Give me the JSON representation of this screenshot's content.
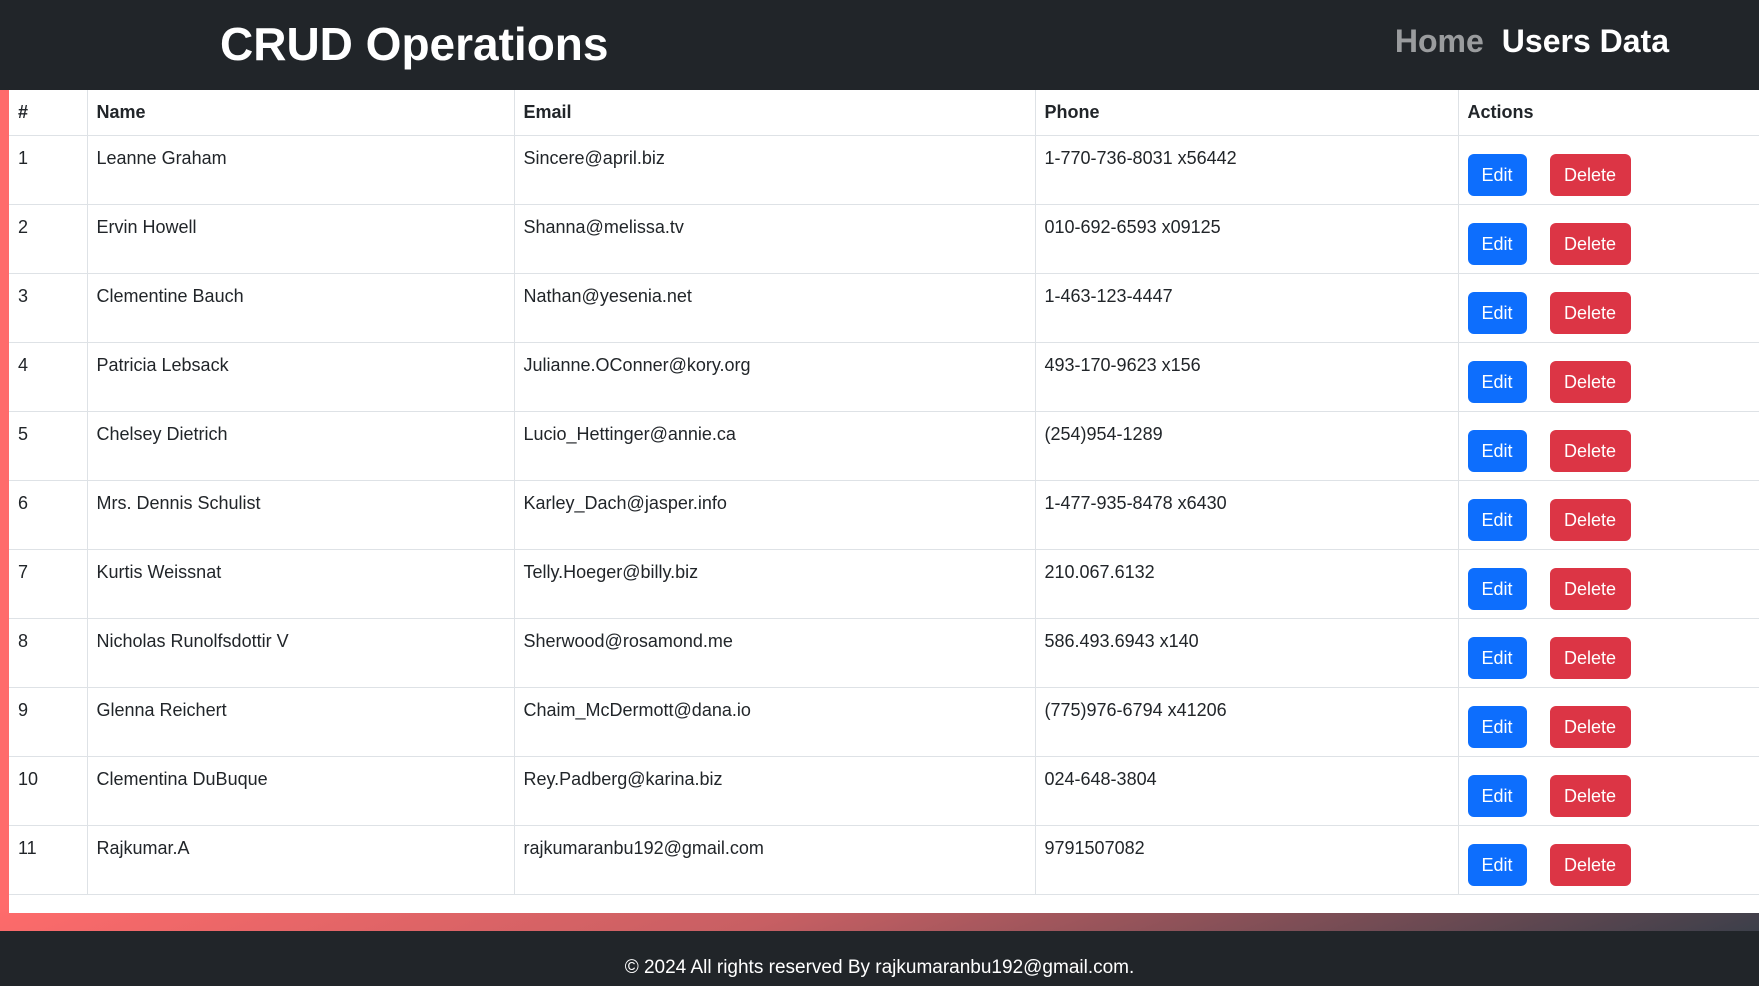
{
  "navbar": {
    "brand": "CRUD Operations",
    "links": [
      {
        "label": "Home",
        "active": false
      },
      {
        "label": "Users Data",
        "active": true
      }
    ]
  },
  "table": {
    "headers": [
      "#",
      "Name",
      "Email",
      "Phone",
      "Actions"
    ],
    "edit_label": "Edit",
    "delete_label": "Delete",
    "rows": [
      {
        "id": "1",
        "name": "Leanne Graham",
        "email": "Sincere@april.biz",
        "phone": "1-770-736-8031 x56442"
      },
      {
        "id": "2",
        "name": "Ervin Howell",
        "email": "Shanna@melissa.tv",
        "phone": "010-692-6593 x09125"
      },
      {
        "id": "3",
        "name": "Clementine Bauch",
        "email": "Nathan@yesenia.net",
        "phone": "1-463-123-4447"
      },
      {
        "id": "4",
        "name": "Patricia Lebsack",
        "email": "Julianne.OConner@kory.org",
        "phone": "493-170-9623 x156"
      },
      {
        "id": "5",
        "name": "Chelsey Dietrich",
        "email": "Lucio_Hettinger@annie.ca",
        "phone": "(254)954-1289"
      },
      {
        "id": "6",
        "name": "Mrs. Dennis Schulist",
        "email": "Karley_Dach@jasper.info",
        "phone": "1-477-935-8478 x6430"
      },
      {
        "id": "7",
        "name": "Kurtis Weissnat",
        "email": "Telly.Hoeger@billy.biz",
        "phone": "210.067.6132"
      },
      {
        "id": "8",
        "name": "Nicholas Runolfsdottir V",
        "email": "Sherwood@rosamond.me",
        "phone": "586.493.6943 x140"
      },
      {
        "id": "9",
        "name": "Glenna Reichert",
        "email": "Chaim_McDermott@dana.io",
        "phone": "(775)976-6794 x41206"
      },
      {
        "id": "10",
        "name": "Clementina DuBuque",
        "email": "Rey.Padberg@karina.biz",
        "phone": "024-648-3804"
      },
      {
        "id": "11",
        "name": "Rajkumar.A",
        "email": "rajkumaranbu192@gmail.com",
        "phone": "9791507082"
      }
    ]
  },
  "footer": {
    "text": "© 2024 All rights reserved By rajkumaranbu192@gmail.com."
  },
  "colors": {
    "navbar_bg": "#212529",
    "edit_button": "#0d6efd",
    "delete_button": "#dc3545",
    "accent_gradient_start": "#ff6b6b"
  }
}
